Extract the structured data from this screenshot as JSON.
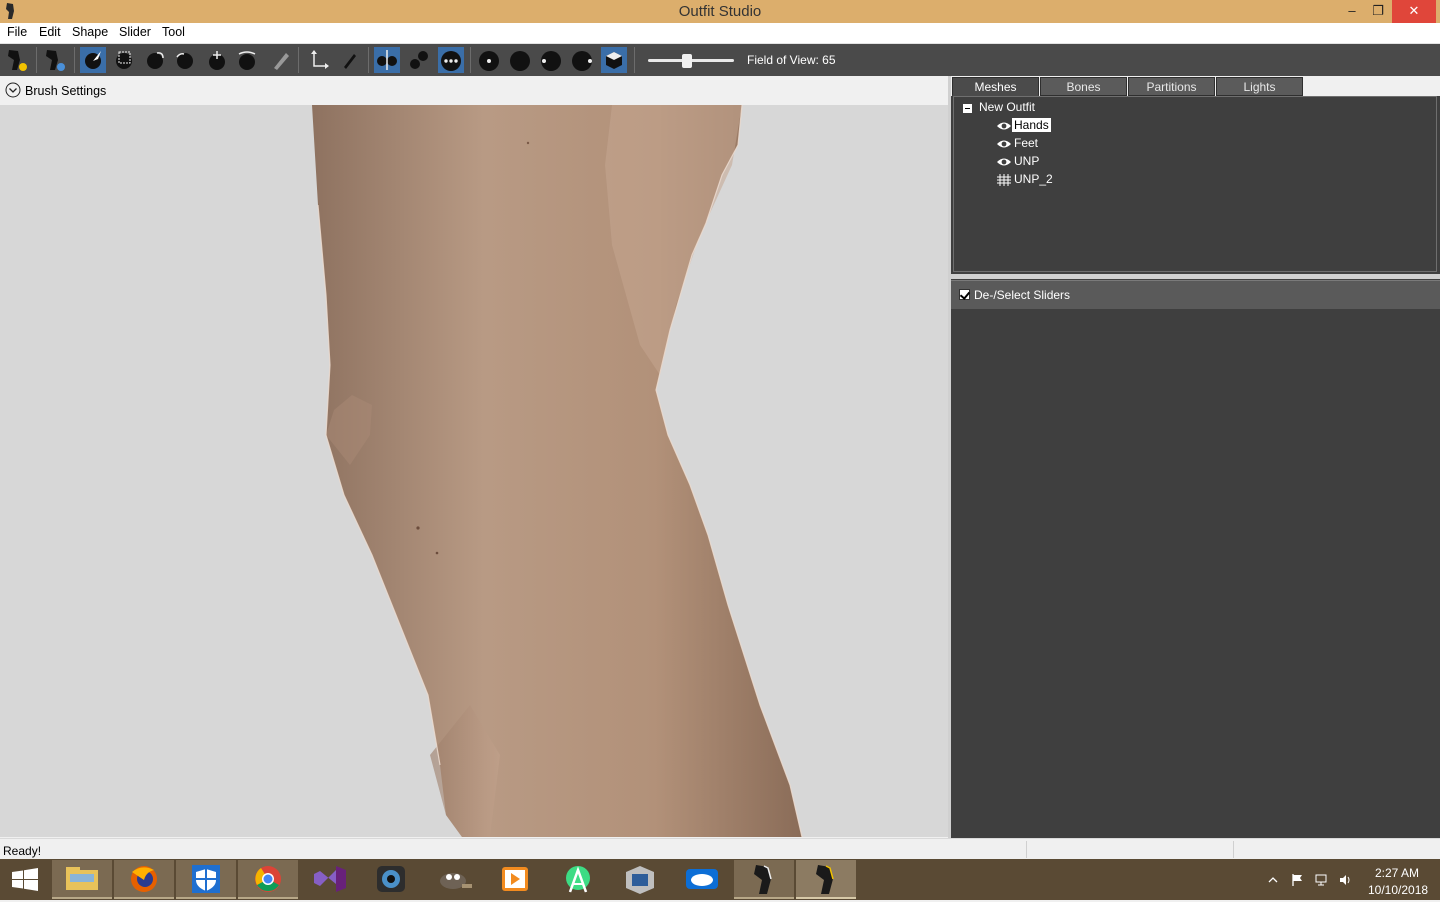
{
  "window": {
    "title": "Outfit Studio",
    "minimize": "–",
    "maximize": "❐",
    "close": "✕"
  },
  "menu": [
    "File",
    "Edit",
    "Shape",
    "Slider",
    "Tool"
  ],
  "toolbar": {
    "fov_label": "Field of View: 65",
    "fov_value": 65
  },
  "brush_settings": {
    "label": "Brush Settings",
    "expanded": true
  },
  "tabs": [
    {
      "label": "Meshes",
      "active": true
    },
    {
      "label": "Bones"
    },
    {
      "label": "Partitions"
    },
    {
      "label": "Lights"
    }
  ],
  "tree": {
    "root": "New Outfit",
    "items": [
      {
        "label": "Hands",
        "icon": "eye-icon",
        "selected": true
      },
      {
        "label": "Feet",
        "icon": "eye-icon"
      },
      {
        "label": "UNP",
        "icon": "eye-icon"
      },
      {
        "label": "UNP_2",
        "icon": "grid-icon"
      }
    ]
  },
  "sliders": {
    "deselect_label": "De-/Select Sliders",
    "checked": true
  },
  "status": {
    "text": "Ready!"
  },
  "taskbar": {
    "time": "2:27 AM",
    "date": "10/10/2018",
    "apps": [
      "windows-start",
      "file-explorer",
      "firefox",
      "windows-defender",
      "chrome",
      "visual-studio",
      "camera-app",
      "gimp",
      "media-player",
      "android-studio",
      "virtualbox",
      "dropbox",
      "outfit-studio-1",
      "outfit-studio-2"
    ]
  },
  "colors": {
    "titlebar": "#dcae6c",
    "toolbar": "#4a4a4a",
    "panel": "#3f3f3f",
    "accent": "#3a6ea8",
    "taskbar": "#5a4a34",
    "skin": "#b8977e"
  }
}
